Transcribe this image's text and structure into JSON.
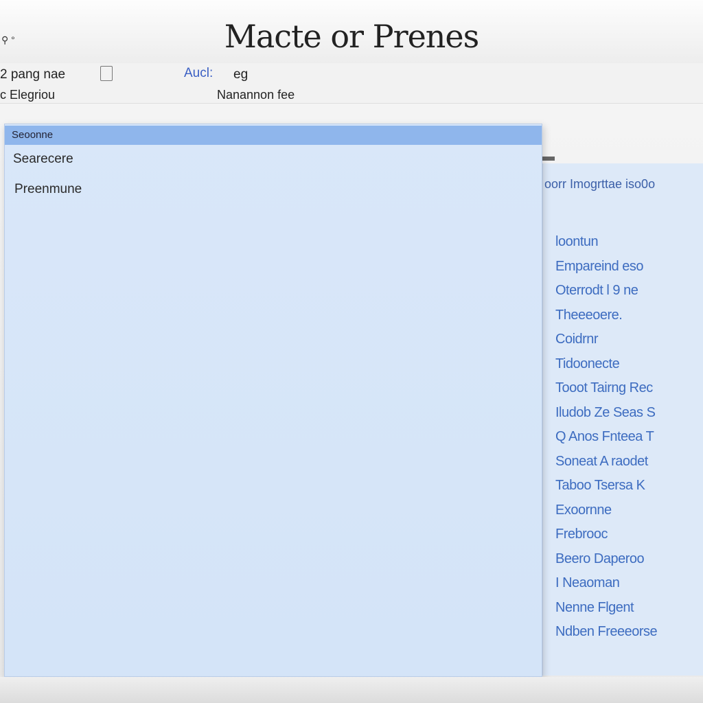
{
  "window": {
    "title": "Macte or Prenes",
    "top_left_glyph": "⚲ °"
  },
  "toolbar": {
    "item_a": "2 pang nae",
    "item_a_icon": "document-icon",
    "item_b": "Aucl:",
    "item_c": "eg",
    "item_d": "c Elegriou",
    "item_e": "Nanannon fee"
  },
  "main_list": {
    "rows": [
      {
        "label": "Seoonne",
        "selected": true
      },
      {
        "label": "Searecere",
        "selected": false
      },
      {
        "label": "Preenmune",
        "selected": false
      }
    ]
  },
  "side_panel": {
    "heading": "oorr Imogrttae iso0o",
    "items": [
      "loontun",
      "Empareind eso",
      "Oterrodt l 9 ne",
      "Theeeoere.",
      "Coidrnr",
      "Tidoonecte",
      "Tooot Tairng Rec",
      "Iludob Ze Seas S",
      "Q Anos Fnteea T",
      "Soneat A raodet",
      "Taboo Tsersa K",
      "Exoornne",
      "Frebrooc",
      "Beero Daperoo",
      "I Neaoman",
      "Nenne Flgent",
      "Ndben Freeeorse"
    ]
  },
  "colors": {
    "accent": "#8fb6ec",
    "panel_bg": "#d9e7f9",
    "link_text": "#3d6cc0"
  }
}
